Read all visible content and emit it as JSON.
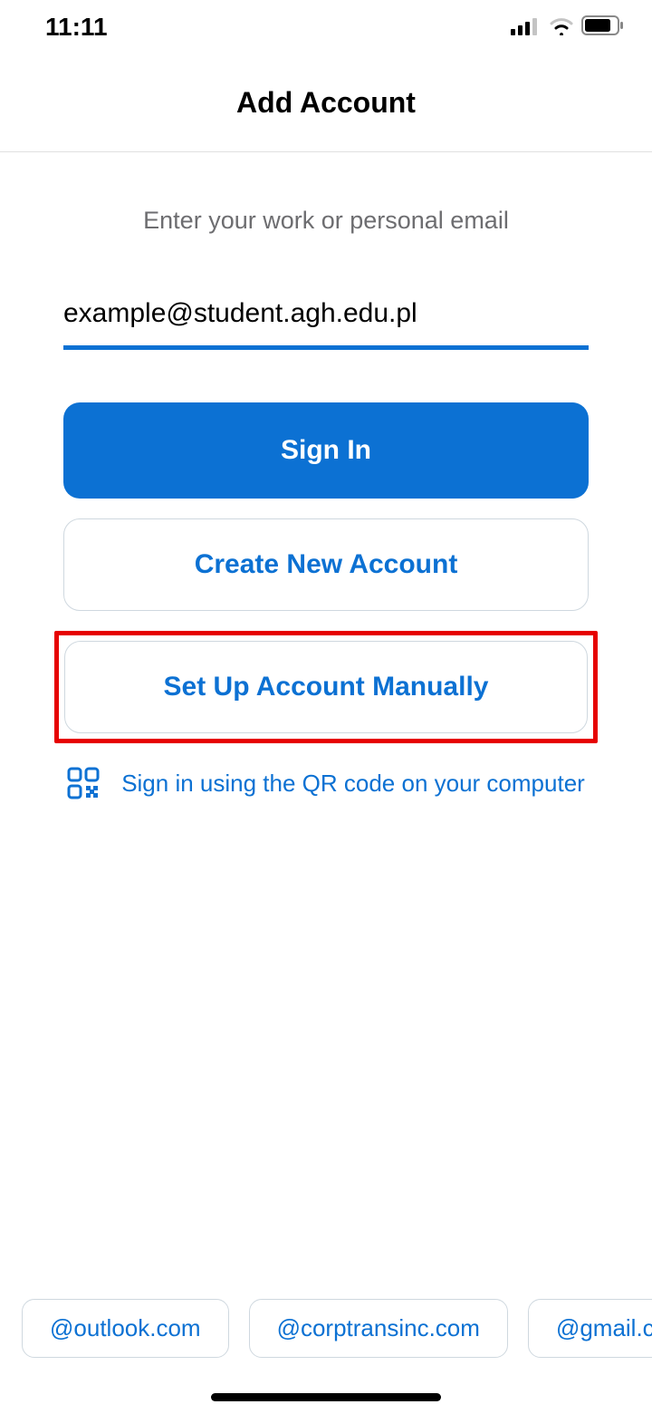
{
  "statusbar": {
    "time": "11:11"
  },
  "header": {
    "title": "Add Account"
  },
  "content": {
    "instruction": "Enter your work or personal email",
    "email_value": "example@student.agh.edu.pl",
    "signin_label": "Sign In",
    "create_label": "Create New Account",
    "manual_label": "Set Up Account Manually",
    "qr_label": "Sign in using the QR code on your computer"
  },
  "domain_suggestions": [
    "@outlook.com",
    "@corptransinc.com",
    "@gmail.c"
  ],
  "colors": {
    "primary": "#0c71d3",
    "highlight_border": "#e60000"
  }
}
